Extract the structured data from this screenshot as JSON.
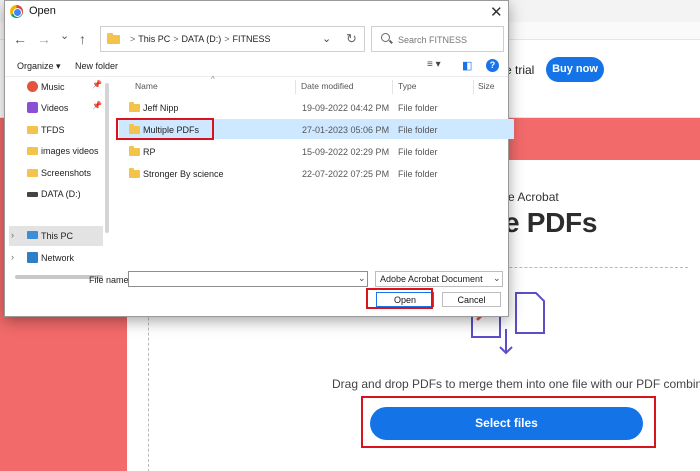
{
  "page": {
    "free_trial_label": "e trial",
    "buy_now_label": "Buy now",
    "eyebrow": "e Acrobat",
    "hero_title": "e PDFs",
    "drop_instruction": "Drag and drop PDFs to merge them into one file with our PDF combiner.",
    "select_files_label": "Select files",
    "colors": {
      "brand_red": "#f26a6a",
      "adobe_blue": "#1473e6",
      "highlight_red": "#d8131e"
    }
  },
  "dialog": {
    "title": "Open",
    "close_glyph": "✕",
    "nav": {
      "back": "←",
      "forward": "→",
      "recent": "⌄",
      "up": "↑"
    },
    "address": {
      "segments": [
        "This PC",
        "DATA (D:)",
        "FITNESS"
      ],
      "separator": ">",
      "dropdown_glyph": "⌄",
      "refresh_glyph": "↻"
    },
    "search_placeholder": "Search FITNESS",
    "toolbar": {
      "organize_label": "Organize ▾",
      "new_folder_label": "New folder",
      "view_glyph": "≡ ▾",
      "pane_glyph": "◧",
      "help_glyph": "?"
    },
    "sidebar": [
      {
        "label": "Music",
        "icon": "music-icon",
        "pinned": true
      },
      {
        "label": "Videos",
        "icon": "videos-icon",
        "pinned": true
      },
      {
        "label": "TFDS",
        "icon": "folder-icon",
        "pinned": false
      },
      {
        "label": "images videos",
        "icon": "folder-icon",
        "pinned": false
      },
      {
        "label": "Screenshots",
        "icon": "folder-icon",
        "pinned": false
      },
      {
        "label": "DATA (D:)",
        "icon": "drive-icon",
        "pinned": false
      },
      {
        "label": "This PC",
        "icon": "computer-icon",
        "pinned": false,
        "expandable": true,
        "selected": true
      },
      {
        "label": "Network",
        "icon": "network-icon",
        "pinned": false,
        "expandable": true
      }
    ],
    "pin_glyph": "📌",
    "expand_glyph": "›",
    "columns": {
      "name": "Name",
      "date": "Date modified",
      "type": "Type",
      "size": "Size"
    },
    "files": [
      {
        "name": "Jeff Nipp",
        "date": "19-09-2022 04:42 PM",
        "type": "File folder"
      },
      {
        "name": "Multiple PDFs",
        "date": "27-01-2023 05:06 PM",
        "type": "File folder",
        "selected": true
      },
      {
        "name": "RP",
        "date": "15-09-2022 02:29 PM",
        "type": "File folder"
      },
      {
        "name": "Stronger By science",
        "date": "22-07-2022 07:25 PM",
        "type": "File folder"
      }
    ],
    "file_name_label": "File name:",
    "file_name_value": "",
    "file_type_value": "Adobe Acrobat Document",
    "dropdown_glyph": "⌄",
    "open_label": "Open",
    "cancel_label": "Cancel"
  }
}
